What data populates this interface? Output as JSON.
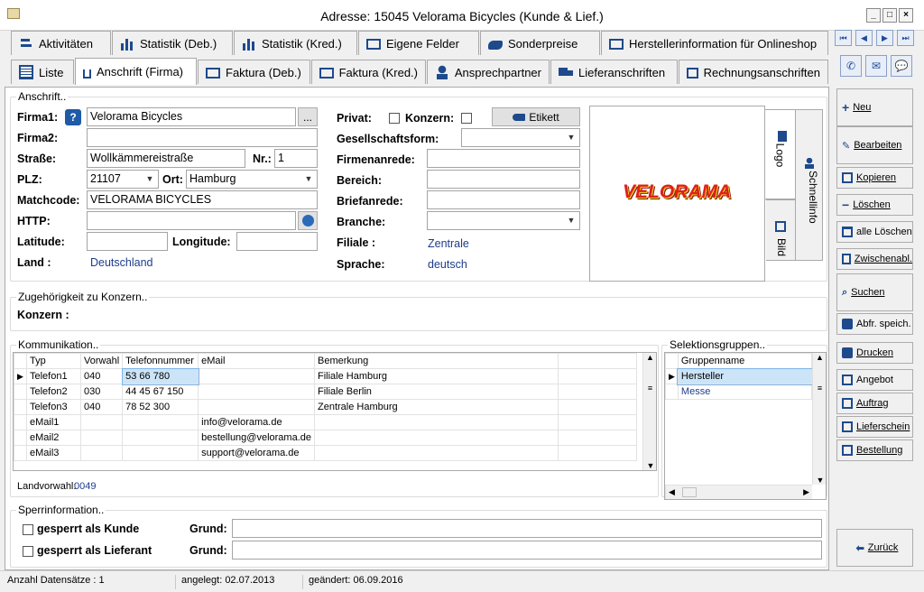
{
  "window": {
    "title": "Adresse: 15045 Velorama Bicycles (Kunde & Lief.)"
  },
  "tabs_row1": [
    {
      "label": "Aktivitäten"
    },
    {
      "label": "Statistik (Deb.)"
    },
    {
      "label": "Statistik (Kred.)"
    },
    {
      "label": "Eigene Felder"
    },
    {
      "label": "Sonderpreise"
    },
    {
      "label": "Herstellerinformation für Onlineshop"
    }
  ],
  "tabs_row2": [
    {
      "label": "Liste"
    },
    {
      "label": "Anschrift (Firma)"
    },
    {
      "label": "Faktura (Deb.)"
    },
    {
      "label": "Faktura (Kred.)"
    },
    {
      "label": "Ansprechpartner"
    },
    {
      "label": "Lieferanschriften"
    },
    {
      "label": "Rechnungsanschriften"
    }
  ],
  "anschrift": {
    "group_label": "Anschrift..",
    "firma1_label": "Firma1:",
    "firma1": "Velorama Bicycles",
    "more_btn": "...",
    "firma2_label": "Firma2:",
    "firma2": "",
    "strasse_label": "Straße:",
    "strasse": "Wollkämmereistraße",
    "nr_label": "Nr.:",
    "nr": "1",
    "plz_label": "PLZ:",
    "plz": "21107",
    "ort_label": "Ort:",
    "ort": "Hamburg",
    "matchcode_label": "Matchcode:",
    "matchcode": "VELORAMA BICYCLES",
    "http_label": "HTTP:",
    "http": "",
    "latitude_label": "Latitude:",
    "latitude": "",
    "longitude_label": "Longitude:",
    "longitude": "",
    "land_label": "Land :",
    "land": "Deutschland",
    "privat_label": "Privat:",
    "konzern_label": "Konzern:",
    "etikett_btn": "Etikett",
    "gesellschaft_label": "Gesellschaftsform:",
    "gesellschaft": "",
    "firmenanrede_label": "Firmenanrede:",
    "bereich_label": "Bereich:",
    "briefanrede_label": "Briefanrede:",
    "branche_label": "Branche:",
    "filiale_label": "Filiale :",
    "filiale": "Zentrale",
    "sprache_label": "Sprache:",
    "sprache": "deutsch",
    "logo_text": "VELORAMA",
    "side_tabs": {
      "logo": "Logo",
      "bild": "Bild",
      "schnellinfo": "Schnellinfo"
    }
  },
  "konzern": {
    "group_label": "Zugehörigkeit zu Konzern..",
    "label": "Konzern :"
  },
  "kommunikation": {
    "group_label": "Kommunikation..",
    "columns": [
      "Typ",
      "Vorwahl",
      "Telefonnummer",
      "eMail",
      "Bemerkung"
    ],
    "rows": [
      [
        "Telefon1",
        "040",
        "53 66 780",
        "",
        "Filiale Hamburg"
      ],
      [
        "Telefon2",
        "030",
        "44 45 67 150",
        "",
        "Filiale Berlin"
      ],
      [
        "Telefon3",
        "040",
        "78 52 300",
        "",
        "Zentrale Hamburg"
      ],
      [
        "eMail1",
        "",
        "",
        "info@velorama.de",
        ""
      ],
      [
        "eMail2",
        "",
        "",
        "bestellung@velorama.de",
        ""
      ],
      [
        "eMail3",
        "",
        "",
        "support@velorama.de",
        ""
      ]
    ],
    "landvorwahl_label": "Landvorwahl:",
    "landvorwahl": "0049"
  },
  "selektion": {
    "group_label": "Selektionsgruppen..",
    "column": "Gruppenname",
    "rows": [
      "Hersteller",
      "Messe"
    ]
  },
  "sperr": {
    "group_label": "Sperrinformation..",
    "kunde_label": "gesperrt als Kunde",
    "lieferant_label": "gesperrt als Lieferant",
    "grund_label": "Grund:"
  },
  "side_buttons": {
    "neu": "Neu",
    "bearbeiten": "Bearbeiten",
    "kopieren": "Kopieren",
    "loeschen": "Löschen",
    "alle_loeschen": "alle Löschen",
    "zwischenabl": "Zwischenabl.",
    "suchen": "Suchen",
    "abfr": "Abfr. speich.",
    "drucken": "Drucken",
    "angebot": "Angebot",
    "auftrag": "Auftrag",
    "lieferschein": "Lieferschein",
    "bestellung": "Bestellung",
    "zurueck": "Zurück"
  },
  "status": {
    "anzahl": "Anzahl Datensätze : 1",
    "angelegt": "angelegt: 02.07.2013",
    "geaendert": "geändert: 06.09.2016"
  },
  "colors": {
    "link": "#1e3c8c",
    "selected_cell": "#cce4f7",
    "logo_red": "#e0201a",
    "logo_yellow": "#f5d020"
  }
}
